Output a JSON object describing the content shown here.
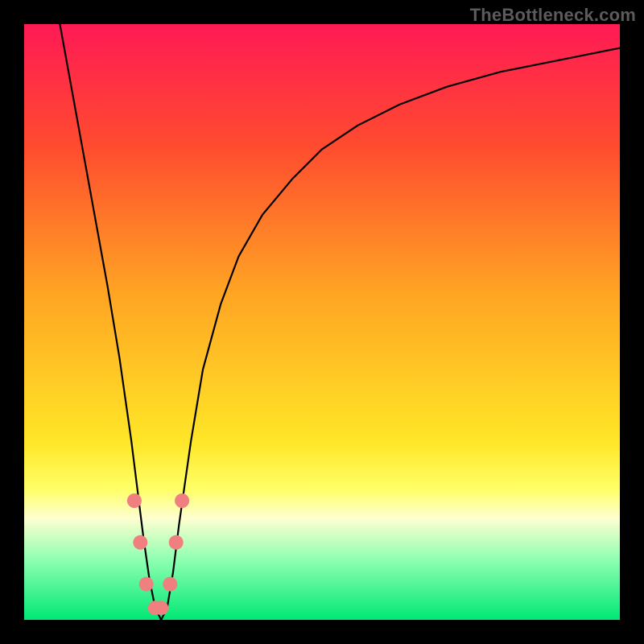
{
  "watermark": "TheBottleneck.com",
  "chart_data": {
    "type": "line",
    "title": "",
    "xlabel": "",
    "ylabel": "",
    "xlim": [
      0,
      100
    ],
    "ylim": [
      0,
      100
    ],
    "gradient_stops": [
      {
        "offset": 0,
        "color": "#ff1a55"
      },
      {
        "offset": 0.2,
        "color": "#ff4a2f"
      },
      {
        "offset": 0.45,
        "color": "#ffa423"
      },
      {
        "offset": 0.7,
        "color": "#ffe627"
      },
      {
        "offset": 0.78,
        "color": "#ffff66"
      },
      {
        "offset": 0.83,
        "color": "#fdffd0"
      },
      {
        "offset": 0.9,
        "color": "#8dffb0"
      },
      {
        "offset": 1.0,
        "color": "#00e874"
      }
    ],
    "series": [
      {
        "name": "bottleneck-curve",
        "color": "#000000",
        "stroke_width": 2.2,
        "x": [
          6,
          8,
          10,
          12,
          14,
          16,
          18,
          19,
          20,
          21,
          22,
          23,
          24,
          25,
          26,
          28,
          30,
          33,
          36,
          40,
          45,
          50,
          56,
          63,
          71,
          80,
          90,
          100
        ],
        "y": [
          100,
          89,
          78,
          67,
          56,
          44,
          30,
          22,
          14,
          7,
          2,
          0,
          2,
          8,
          16,
          30,
          42,
          53,
          61,
          68,
          74,
          79,
          83,
          86.5,
          89.5,
          92,
          94,
          96
        ]
      }
    ],
    "markers": {
      "name": "valley-markers",
      "color": "#f08080",
      "radius": 9,
      "points": [
        {
          "x": 18.5,
          "y": 20
        },
        {
          "x": 19.5,
          "y": 13
        },
        {
          "x": 20.5,
          "y": 6
        },
        {
          "x": 22.0,
          "y": 2
        },
        {
          "x": 23.0,
          "y": 2
        },
        {
          "x": 24.5,
          "y": 6
        },
        {
          "x": 25.5,
          "y": 13
        },
        {
          "x": 26.5,
          "y": 20
        }
      ]
    }
  }
}
